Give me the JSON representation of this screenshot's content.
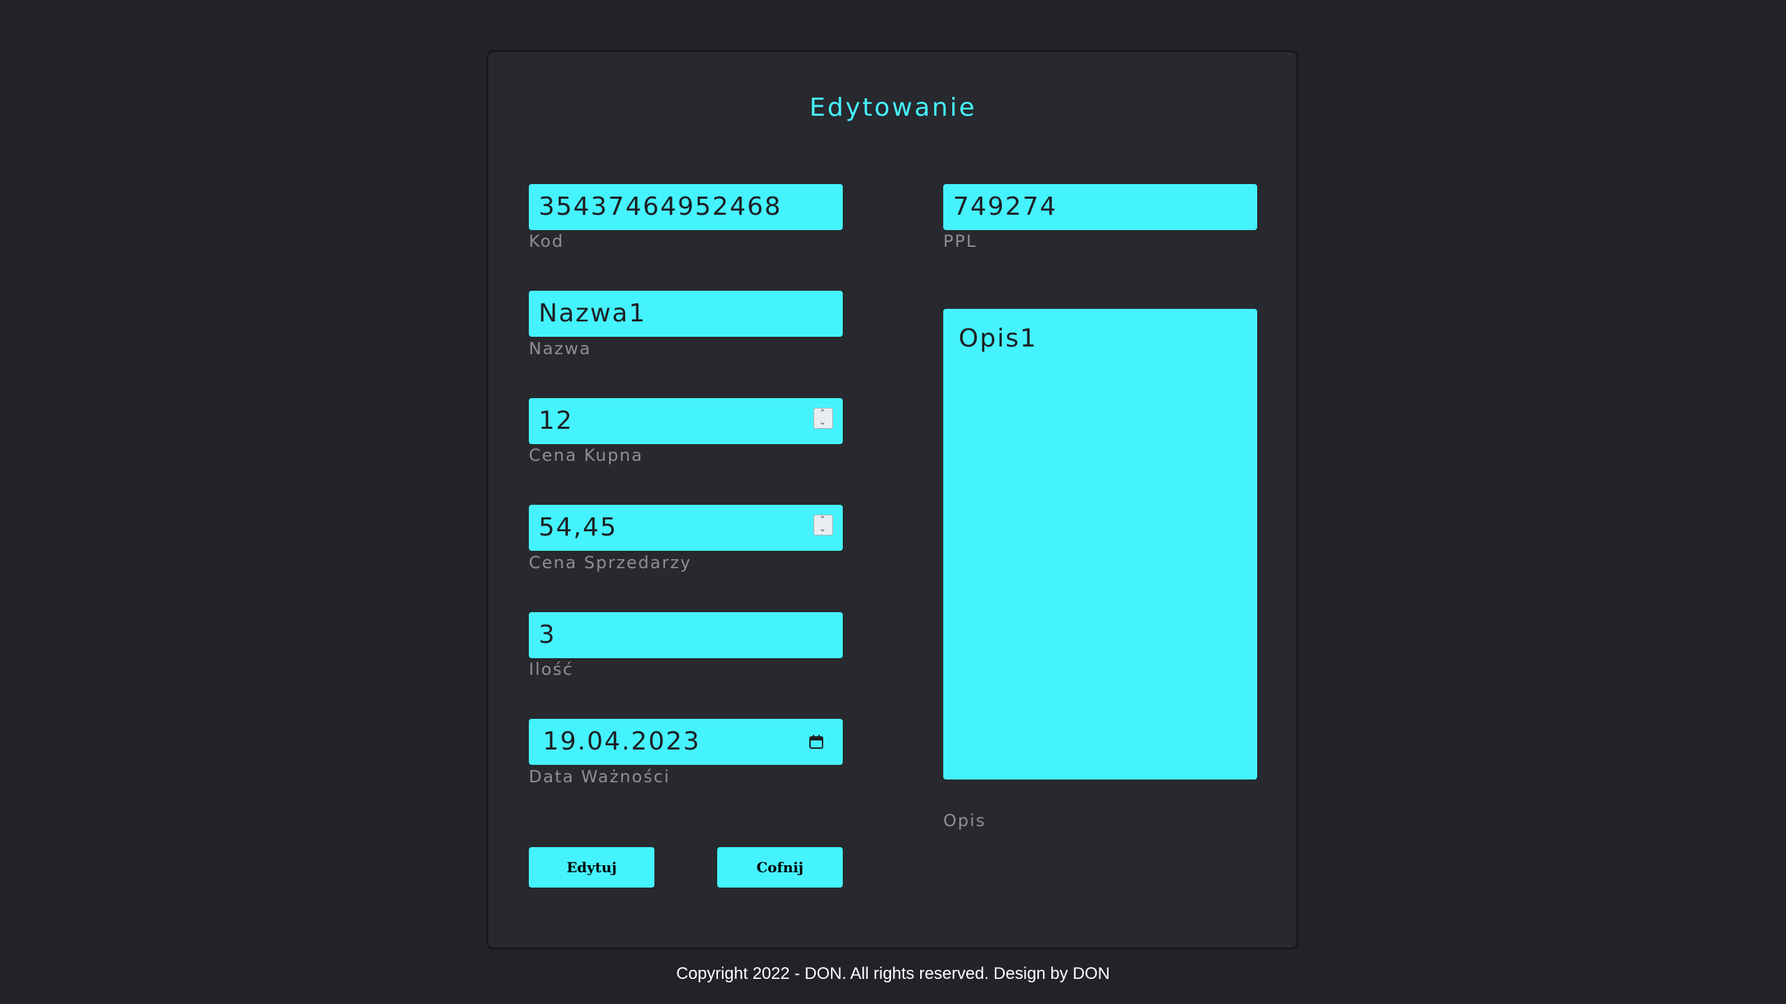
{
  "form": {
    "title": "Edytowanie",
    "fields": {
      "kod": {
        "value": "35437464952468",
        "label": "Kod"
      },
      "ppl": {
        "value": "749274",
        "label": "PPL"
      },
      "nazwa": {
        "value": "Nazwa1",
        "label": "Nazwa"
      },
      "cena_kupna": {
        "value": "12",
        "label": "Cena Kupna"
      },
      "cena_sprzedarzy": {
        "value": "54,45",
        "label": "Cena Sprzedarzy"
      },
      "ilosc": {
        "value": "3",
        "label": "Ilość"
      },
      "data_waznosci": {
        "value": "19.04.2023",
        "label": "Data Ważności"
      },
      "opis": {
        "value": "Opis1",
        "label": "Opis"
      }
    },
    "buttons": {
      "edit_label": "Edytuj",
      "back_label": "Cofnij"
    }
  },
  "footer": {
    "text": "Copyright 2022 - DON. All rights reserved. Design by DON"
  },
  "colors": {
    "background": "#212328",
    "card": "#27292e",
    "accent": "#45f3ff",
    "label": "#8f8f8f",
    "footer_text": "#ffffff"
  },
  "icons": {
    "spinner": "spinner-icon",
    "calendar": "calendar-icon"
  }
}
